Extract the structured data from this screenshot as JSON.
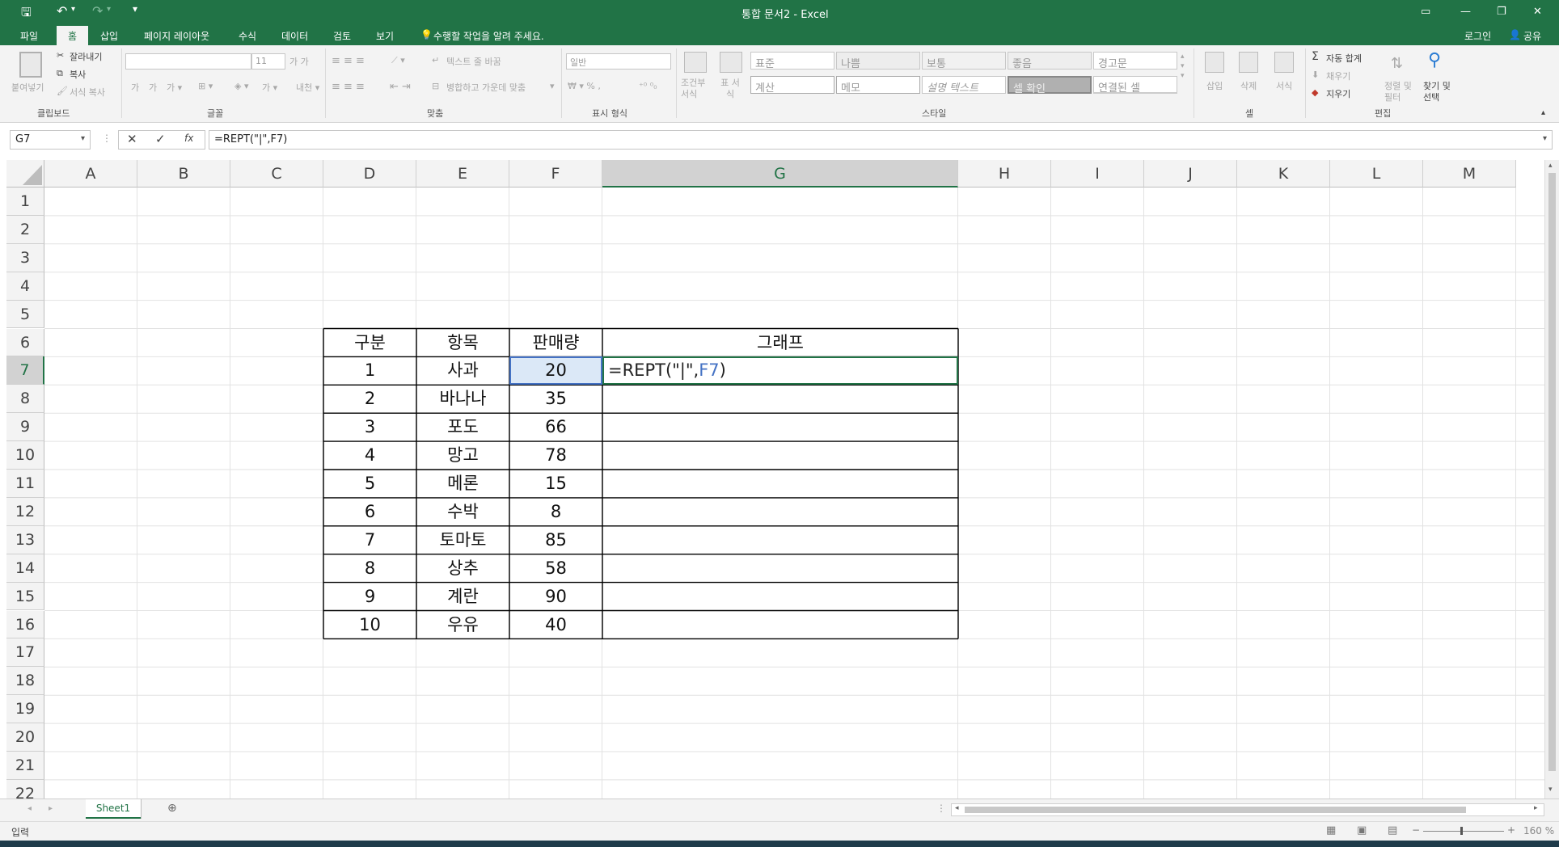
{
  "window": {
    "title": "통합 문서2 - Excel",
    "controls": {
      "minimize": "—",
      "restore": "❐",
      "close": "✕"
    }
  },
  "quick_access": {
    "save": "save-icon",
    "undo": "undo-icon",
    "redo": "redo-icon",
    "customize": "▾"
  },
  "tabs": [
    {
      "label": "파일"
    },
    {
      "label": "홈",
      "active": true
    },
    {
      "label": "삽입"
    },
    {
      "label": "페이지 레이아웃"
    },
    {
      "label": "수식"
    },
    {
      "label": "데이터"
    },
    {
      "label": "검토"
    },
    {
      "label": "보기"
    }
  ],
  "tell_me": "수행할 작업을 알려 주세요.",
  "account": {
    "login": "로그인",
    "share": "공유"
  },
  "ribbon": {
    "clipboard": {
      "paste": "붙여넣기",
      "cut": "잘라내기",
      "copy": "복사",
      "format_painter": "서식 복사",
      "group": "클립보드"
    },
    "font": {
      "font_name": "",
      "font_size": "11",
      "group": "글꼴"
    },
    "alignment": {
      "wrap": "텍스트 줄 바꿈",
      "merge": "병합하고 가운데 맞춤",
      "group": "맞춤"
    },
    "number": {
      "format": "일반",
      "group": "표시 형식"
    },
    "styles": {
      "conditional": "조건부 서식",
      "table": "표 서식",
      "group": "스타일",
      "cells": [
        [
          "표준",
          "나쁨",
          "보통",
          "좋음",
          "경고문"
        ],
        [
          "계산",
          "메모",
          "설명 텍스트",
          "셀 확인",
          "연결된 셀"
        ]
      ]
    },
    "cells": {
      "insert": "삽입",
      "delete": "삭제",
      "format": "서식",
      "group": "셀"
    },
    "editing": {
      "autosum": "자동 합계",
      "fill": "채우기",
      "clear": "지우기",
      "sort": "정렬 및 필터",
      "find": "찾기 및 선택",
      "group": "편집"
    }
  },
  "formula_bar": {
    "name_box": "G7",
    "formula": "=REPT(\"|\",F7)",
    "cancel": "✕",
    "enter": "✓",
    "fx": "fx"
  },
  "columns": [
    "A",
    "B",
    "C",
    "D",
    "E",
    "F",
    "G",
    "H",
    "I",
    "J",
    "K",
    "L",
    "M"
  ],
  "rows": [
    "1",
    "2",
    "3",
    "4",
    "5",
    "6",
    "7",
    "8",
    "9",
    "10",
    "11",
    "12",
    "13",
    "14",
    "15",
    "16",
    "17",
    "18",
    "19",
    "20",
    "21",
    "22"
  ],
  "table": {
    "headers": [
      "구분",
      "항목",
      "판매량",
      "그래프"
    ],
    "rows": [
      [
        "1",
        "사과",
        "20",
        ""
      ],
      [
        "2",
        "바나나",
        "35",
        ""
      ],
      [
        "3",
        "포도",
        "66",
        ""
      ],
      [
        "4",
        "망고",
        "78",
        ""
      ],
      [
        "5",
        "메론",
        "15",
        ""
      ],
      [
        "6",
        "수박",
        "8",
        ""
      ],
      [
        "7",
        "토마토",
        "85",
        ""
      ],
      [
        "8",
        "상추",
        "58",
        ""
      ],
      [
        "9",
        "계란",
        "90",
        ""
      ],
      [
        "10",
        "우유",
        "40",
        ""
      ]
    ],
    "editing_cell": {
      "prefix": "=REPT(\"|\",",
      "ref": "F7",
      "suffix": ")"
    }
  },
  "sheets": [
    {
      "name": "Sheet1",
      "active": true
    }
  ],
  "status": {
    "mode": "입력",
    "zoom": "160 %"
  }
}
